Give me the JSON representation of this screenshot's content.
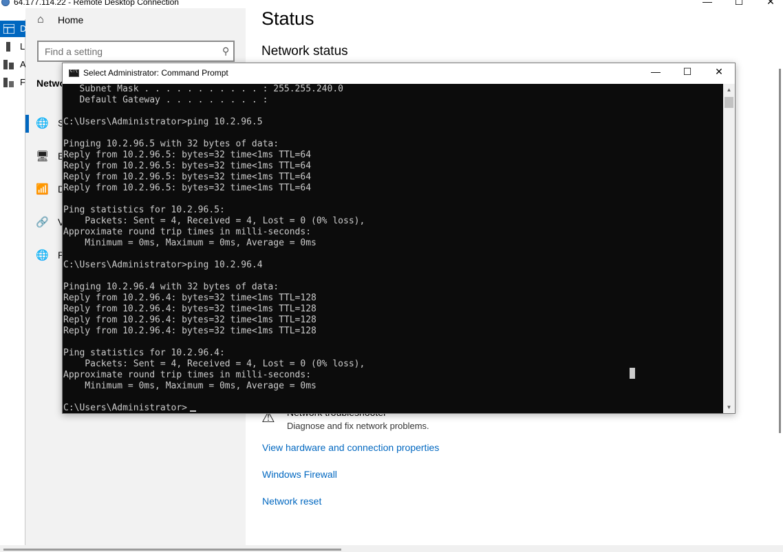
{
  "rdp": {
    "title": "64.177.114.22 - Remote Desktop Connection",
    "minimize": "—",
    "maximize": "☐",
    "close": "✕"
  },
  "strip": [
    {
      "letter": "D"
    },
    {
      "letter": "L"
    },
    {
      "letter": "A"
    },
    {
      "letter": "F"
    }
  ],
  "settings": {
    "home_label": "Home",
    "search_placeholder": "Find a setting",
    "section_label": "Netwo",
    "nav": [
      {
        "icon": "🌐",
        "label": "S"
      },
      {
        "icon": "🖥",
        "label": "E"
      },
      {
        "icon": "📶",
        "label": "D"
      },
      {
        "icon": "🔗",
        "label": "V"
      },
      {
        "icon": "🌐",
        "label": "P"
      }
    ],
    "page_title": "Status",
    "section_title": "Network status",
    "troubleshooter_title": "Network troubleshooter",
    "troubleshooter_desc": "Diagnose and fix network problems.",
    "links": [
      "View hardware and connection properties",
      "Windows Firewall",
      "Network reset"
    ]
  },
  "cmd": {
    "title": "Select Administrator: Command Prompt",
    "minimize": "—",
    "maximize": "☐",
    "close": "✕",
    "scroll_up": "▲",
    "scroll_down": "▼",
    "lines": [
      "   Subnet Mask . . . . . . . . . . . : 255.255.240.0",
      "   Default Gateway . . . . . . . . . :",
      "",
      "C:\\Users\\Administrator>ping 10.2.96.5",
      "",
      "Pinging 10.2.96.5 with 32 bytes of data:",
      "Reply from 10.2.96.5: bytes=32 time<1ms TTL=64",
      "Reply from 10.2.96.5: bytes=32 time<1ms TTL=64",
      "Reply from 10.2.96.5: bytes=32 time<1ms TTL=64",
      "Reply from 10.2.96.5: bytes=32 time<1ms TTL=64",
      "",
      "Ping statistics for 10.2.96.5:",
      "    Packets: Sent = 4, Received = 4, Lost = 0 (0% loss),",
      "Approximate round trip times in milli-seconds:",
      "    Minimum = 0ms, Maximum = 0ms, Average = 0ms",
      "",
      "C:\\Users\\Administrator>ping 10.2.96.4",
      "",
      "Pinging 10.2.96.4 with 32 bytes of data:",
      "Reply from 10.2.96.4: bytes=32 time<1ms TTL=128",
      "Reply from 10.2.96.4: bytes=32 time<1ms TTL=128",
      "Reply from 10.2.96.4: bytes=32 time<1ms TTL=128",
      "Reply from 10.2.96.4: bytes=32 time<1ms TTL=128",
      "",
      "Ping statistics for 10.2.96.4:",
      "    Packets: Sent = 4, Received = 4, Lost = 0 (0% loss),",
      "Approximate round trip times in milli-seconds:",
      "    Minimum = 0ms, Maximum = 0ms, Average = 0ms",
      "",
      "C:\\Users\\Administrator>"
    ]
  }
}
